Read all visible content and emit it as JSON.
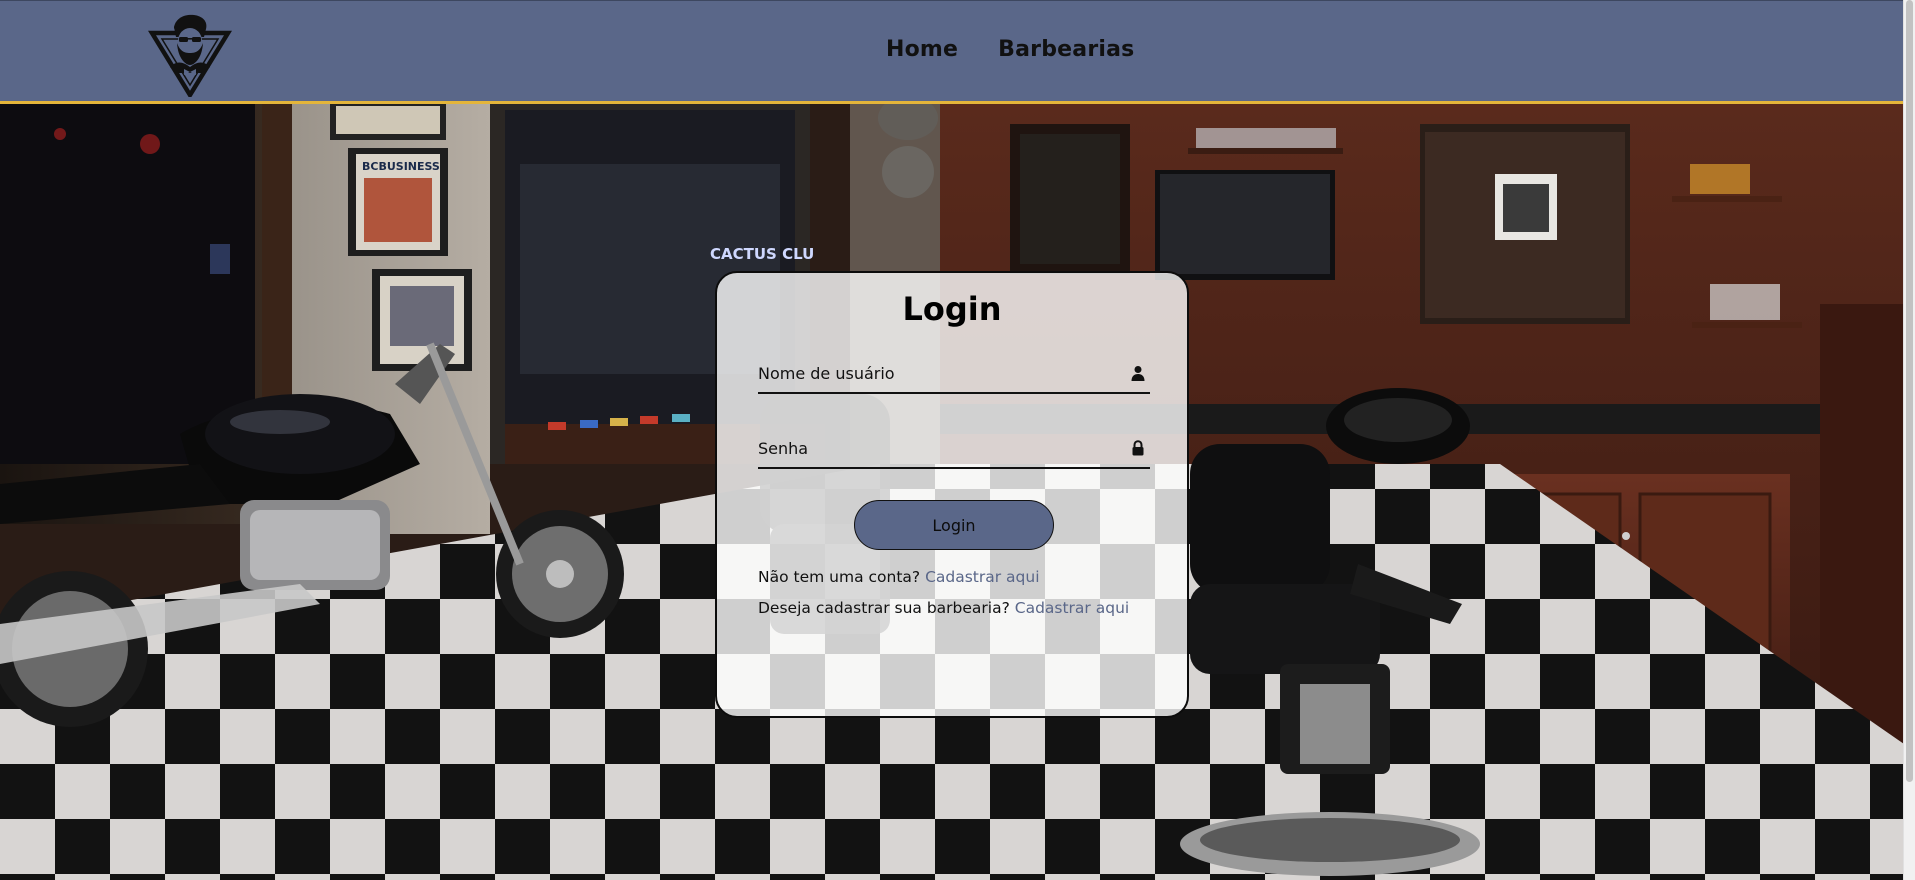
{
  "header": {
    "logo_icon": "barber-logo-icon",
    "nav": [
      {
        "label": "Home"
      },
      {
        "label": "Barbearias"
      }
    ],
    "background_color": "#5a6789",
    "border_color": "#e4b53a"
  },
  "login": {
    "title": "Login",
    "username": {
      "placeholder": "Nome de usuário",
      "icon": "user-icon"
    },
    "password": {
      "placeholder": "Senha",
      "icon": "lock-icon"
    },
    "button_label": "Login",
    "no_account_text": "Não tem uma conta?",
    "no_account_link": "Cadastrar aqui",
    "register_shop_text": "Deseja cadastrar sua barbearia?",
    "register_shop_link": "Cadastrar aqui",
    "accent_color": "#5a6789"
  },
  "background": {
    "neon_sign": "CACTUS CLU",
    "magazine_cover": "BCBUSINESS"
  }
}
